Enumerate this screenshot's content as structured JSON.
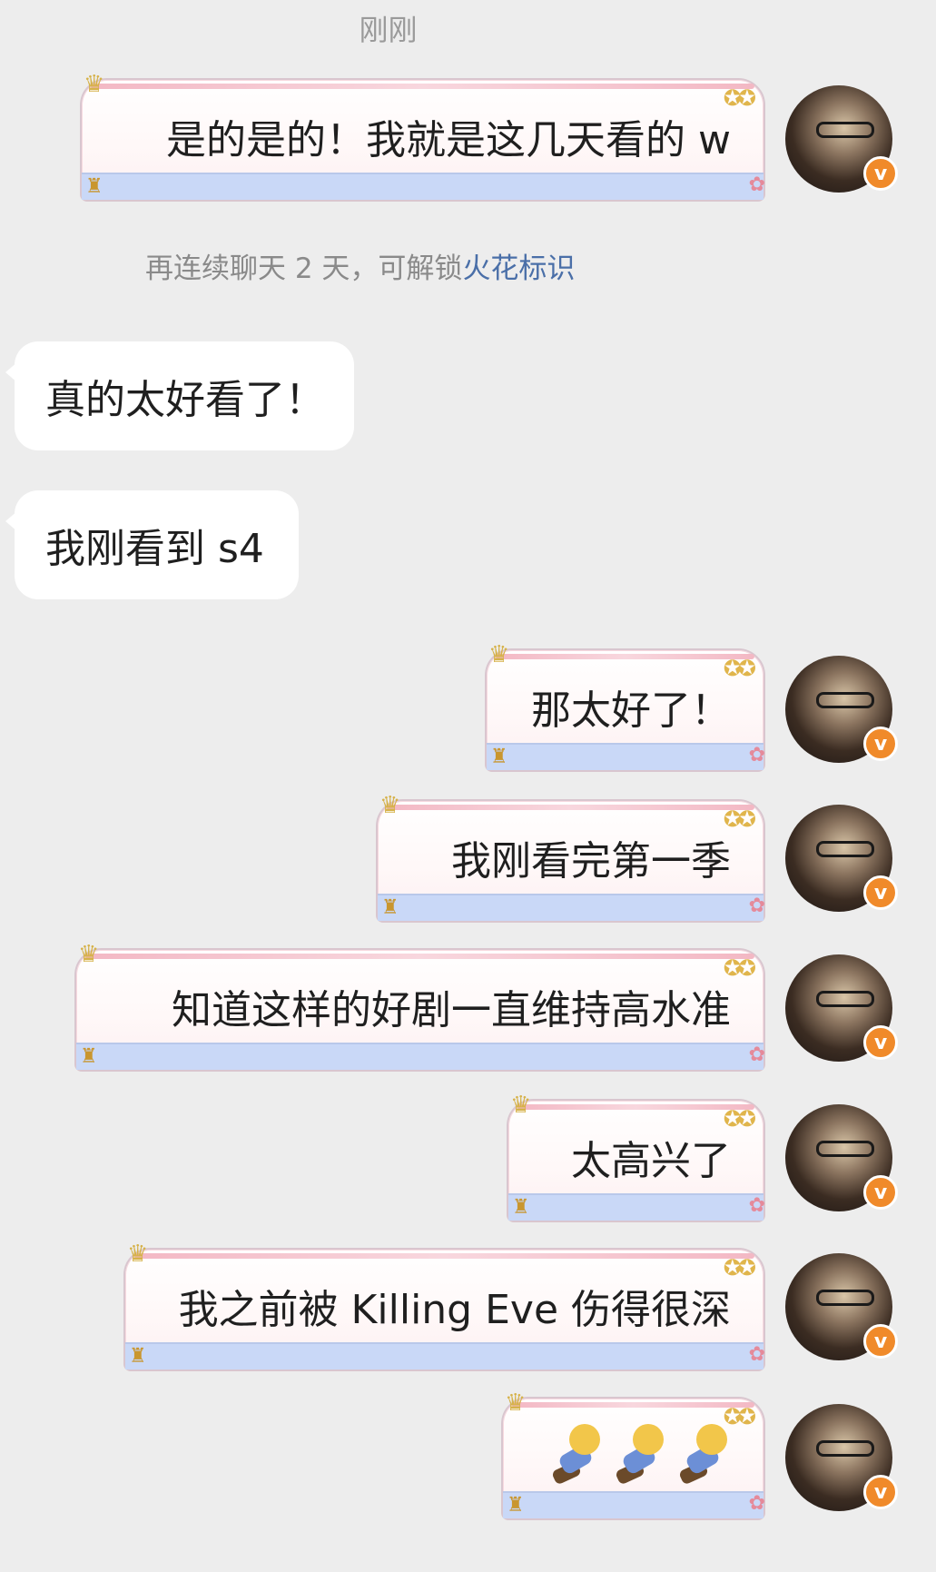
{
  "timestamp": "刚刚",
  "hint": {
    "text": "再连续聊天 2 天，可解锁",
    "link": "火花标识"
  },
  "badge_letter": "v",
  "messages": [
    {
      "side": "out",
      "text": "是的是的！我就是这几天看的 w"
    },
    {
      "side": "in",
      "text": "真的太好看了！"
    },
    {
      "side": "in",
      "text": "我刚看到 s4"
    },
    {
      "side": "out",
      "text": "那太好了！"
    },
    {
      "side": "out",
      "text": "我刚看完第一季"
    },
    {
      "side": "out",
      "text": "知道这样的好剧一直维持高水准"
    },
    {
      "side": "out",
      "text": "太高兴了"
    },
    {
      "side": "out",
      "text": "我之前被 Killing Eve 伤得很深"
    },
    {
      "side": "out",
      "text": "",
      "sticker": "three-figures-emoji"
    }
  ]
}
